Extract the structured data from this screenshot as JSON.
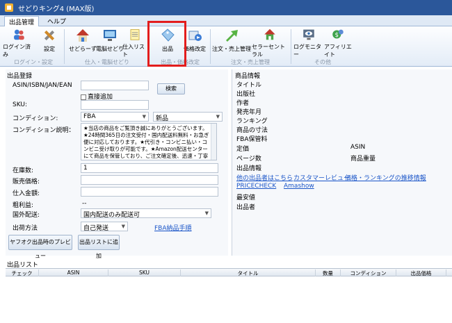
{
  "window": {
    "title": "せどりキング4 (MAX版)"
  },
  "ribbon_tabs": [
    "出品管理",
    "ヘルプ"
  ],
  "ribbon_buttons": [
    {
      "label": "ログイン済み",
      "icon": "people-icon"
    },
    {
      "label": "設定",
      "icon": "tools-icon"
    },
    {
      "label": "せどらーず",
      "icon": "house-icon"
    },
    {
      "label": "電脳せどり",
      "icon": "monitor-icon"
    },
    {
      "label": "仕入リスト",
      "icon": "notepad-icon"
    },
    {
      "label": "出品",
      "icon": "tag-icon"
    },
    {
      "label": "価格改定",
      "icon": "price-icon"
    },
    {
      "label": "注文・売上管理",
      "icon": "arrow-up-icon"
    },
    {
      "label": "セラーセントラル",
      "icon": "house-green-icon"
    },
    {
      "label": "ログモニター",
      "icon": "eye-icon"
    },
    {
      "label": "アフィリエイト",
      "icon": "money-icon"
    }
  ],
  "ribbon_groups": [
    "ログイン・設定",
    "仕入・電脳せどり",
    "出品・価格改定",
    "注文・売上管理",
    "その他"
  ],
  "left": {
    "section_title": "出品登録",
    "asin_label": "ASIN/ISBN/JAN/EAN",
    "asin_value": "",
    "direct_add_label": "直接追加",
    "search_button": "検索",
    "sku_label": "SKU:",
    "sku_value": "",
    "condition_label": "コンディション:",
    "condition_value": "FBA",
    "condition_sub_value": "新品",
    "condition_desc_label": "コンディション説明：",
    "condition_desc_text": "★当店の商品をご覧頂き誠にありがとうございます。★24時間365日の注文受付・国内配送料無料・お急ぎ便に対応しております。★代引き・コンビニ払い・コンビニ受け取りが可能です。★Amazon配送センターにて商品を保管しており、ご注文確定後、迅速・丁寧に梱包し発送を行な",
    "stock_label": "在庫数:",
    "stock_value": "1",
    "sale_price_label": "販売価格:",
    "sale_price_value": "",
    "purchase_label": "仕入金額:",
    "purchase_value": "",
    "gross_label": "粗利益:",
    "gross_value": "--",
    "overseas_label": "国外配送:",
    "overseas_value": "国内配送のみ配送可",
    "shipping_label": "出荷方法",
    "shipping_value": "自己発送",
    "fba_link": "FBA納品手順",
    "yahoo_preview_button": "ヤフオク出品時のプレビュー",
    "add_list_button": "出品リストに追加"
  },
  "right": {
    "section_title": "商品情報",
    "fields": [
      "タイトル",
      "出版社",
      "作者",
      "発売年月",
      "ランキング",
      "商品の寸法",
      "FBA保管料"
    ],
    "price_label": "定価",
    "asin_label": "ASIN",
    "pages_label": "ページ数",
    "weight_label": "商品重量",
    "seller_info_label": "出品情報",
    "links": [
      "他の出品者はこちら",
      "カスタマーレビュー",
      "価格・ランキングの推移情報",
      "PRICECHECK",
      "Amashow"
    ],
    "lowest_label": "最安値",
    "seller_label": "出品者"
  },
  "list": {
    "title": "出品リスト",
    "columns": [
      "チェック",
      "ASIN",
      "SKU",
      "タイトル",
      "数量",
      "コンディション",
      "出品価格"
    ]
  }
}
